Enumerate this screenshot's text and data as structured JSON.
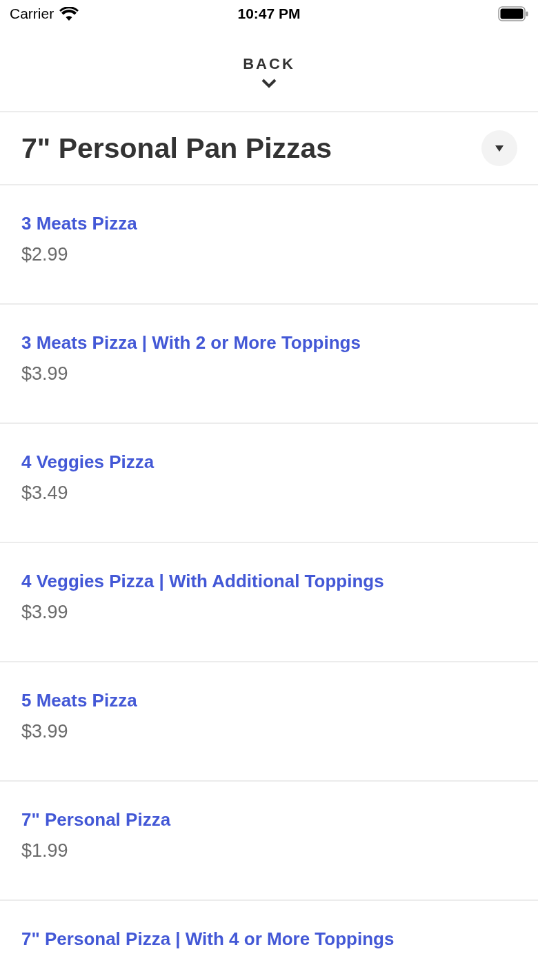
{
  "status_bar": {
    "carrier": "Carrier",
    "time": "10:47 PM"
  },
  "header": {
    "back_label": "BACK"
  },
  "section": {
    "title": "7\" Personal Pan Pizzas"
  },
  "items": [
    {
      "name": "3 Meats Pizza",
      "price": "$2.99"
    },
    {
      "name": "3 Meats Pizza | With 2 or More Toppings",
      "price": "$3.99"
    },
    {
      "name": "4 Veggies Pizza",
      "price": "$3.49"
    },
    {
      "name": "4 Veggies Pizza | With Additional Toppings",
      "price": "$3.99"
    },
    {
      "name": "5 Meats Pizza",
      "price": "$3.99"
    },
    {
      "name": "7\" Personal Pizza",
      "price": "$1.99"
    },
    {
      "name": "7\" Personal Pizza | With 4 or More Toppings"
    }
  ]
}
